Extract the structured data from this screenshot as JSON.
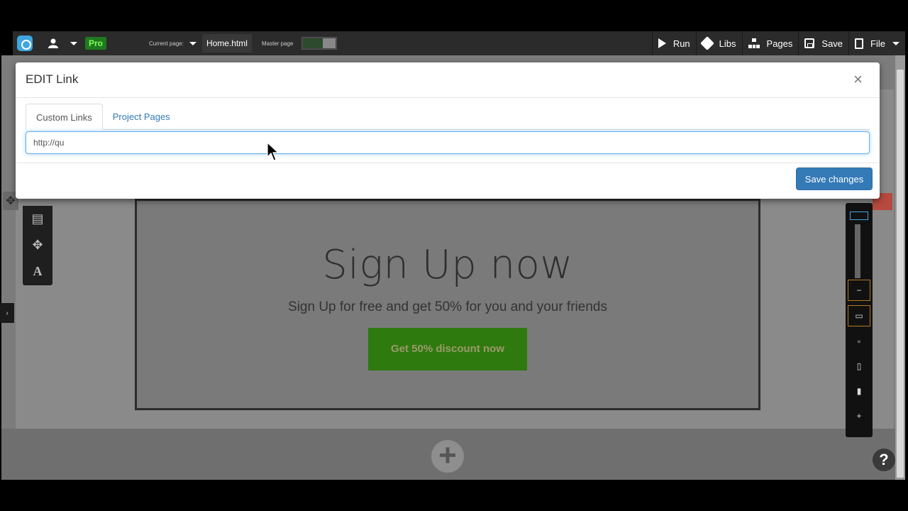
{
  "toolbar": {
    "pro_badge": "Pro",
    "current_page_label": "Current page:",
    "current_page_value": "Home.html",
    "master_page_label": "Master page",
    "run_label": "Run",
    "libs_label": "Libs",
    "pages_label": "Pages",
    "save_label": "Save",
    "file_label": "File"
  },
  "canvas": {
    "heading": "Sign Up now",
    "subheading": "Sign Up for free and get 50% for you and your friends",
    "cta_label": "Get 50% discount now"
  },
  "modal": {
    "title": "EDIT Link",
    "close_glyph": "×",
    "tabs": [
      {
        "label": "Custom Links",
        "active": true
      },
      {
        "label": "Project Pages",
        "active": false
      }
    ],
    "link_value": "http://qu",
    "save_label": "Save changes"
  },
  "help_label": "?",
  "colors": {
    "primary": "#337ab7",
    "cta_green": "#2f7a0f",
    "toolbar": "#2b2b2b",
    "pro_green": "#1f7a1f"
  }
}
